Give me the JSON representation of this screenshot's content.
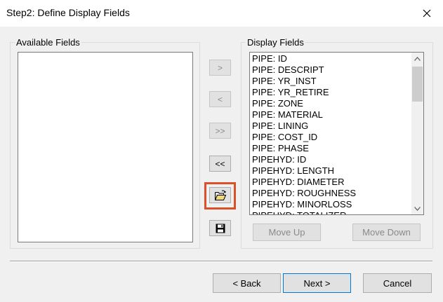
{
  "window": {
    "title": "Step2: Define Display Fields"
  },
  "available_fields": {
    "label": "Available Fields",
    "items": []
  },
  "display_fields": {
    "label": "Display Fields",
    "items": [
      "PIPE: ID",
      "PIPE: DESCRIPT",
      "PIPE: YR_INST",
      "PIPE: YR_RETIRE",
      "PIPE: ZONE",
      "PIPE: MATERIAL",
      "PIPE: LINING",
      "PIPE: COST_ID",
      "PIPE: PHASE",
      "PIPEHYD: ID",
      "PIPEHYD: LENGTH",
      "PIPEHYD: DIAMETER",
      "PIPEHYD: ROUGHNESS",
      "PIPEHYD: MINORLOSS",
      "PIPEHYD: TOTALIZER"
    ]
  },
  "move_buttons": {
    "add": ">",
    "remove": "<",
    "add_all": ">>",
    "remove_all": "<<"
  },
  "order_buttons": {
    "move_up": "Move Up",
    "move_down": "Move Down"
  },
  "footer": {
    "back": "< Back",
    "next": "Next >",
    "cancel": "Cancel"
  },
  "colors": {
    "highlight": "#d9502b",
    "default_button_border": "#0078d7"
  }
}
